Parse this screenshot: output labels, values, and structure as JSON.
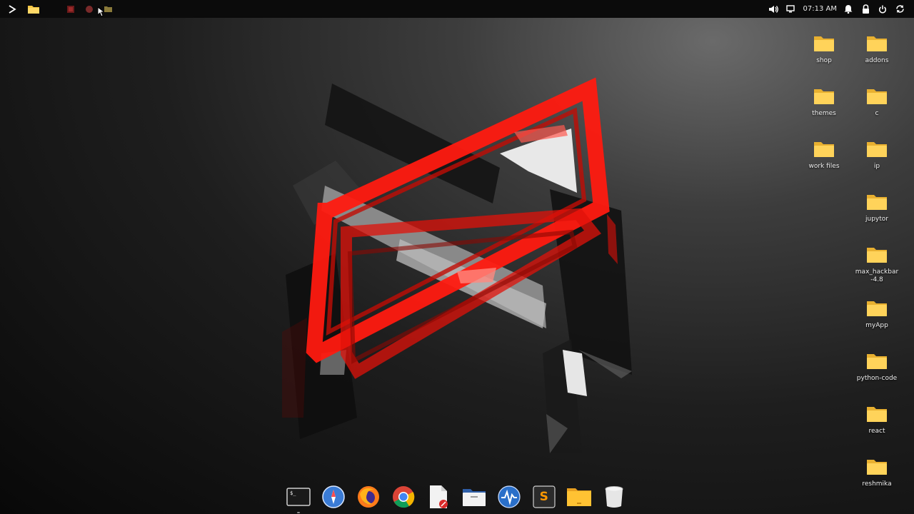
{
  "top_panel": {
    "clock": "07:13 AM",
    "launcher_icon": "play-triangle-icon",
    "files_icon": "folder-icon",
    "indicators": [
      "volume-icon",
      "display-icon",
      "notification-bell-icon",
      "lock-icon",
      "power-icon",
      "refresh-icon"
    ]
  },
  "desktop": {
    "icons": [
      {
        "label": "shop"
      },
      {
        "label": "addons"
      },
      {
        "label": "themes"
      },
      {
        "label": "c"
      },
      {
        "label": "work files"
      },
      {
        "label": "ip"
      },
      {
        "label": "jupytor"
      },
      {
        "label": "max_hackbar -4.8"
      },
      {
        "label": "myApp"
      },
      {
        "label": "python-code"
      },
      {
        "label": "react"
      },
      {
        "label": "reshmika"
      }
    ]
  },
  "dock": {
    "items": [
      "terminal-icon",
      "safari-compass-icon",
      "firefox-icon",
      "chrome-icon",
      "text-editor-icon",
      "file-manager-icon",
      "system-monitor-icon",
      "sublime-text-icon",
      "folder-icon",
      "trash-icon"
    ],
    "sublime_letter": "S"
  },
  "colors": {
    "panel_bg": "#0b0b0b",
    "folder_yellow": "#f5c542",
    "accent_red": "#ff1a10"
  }
}
